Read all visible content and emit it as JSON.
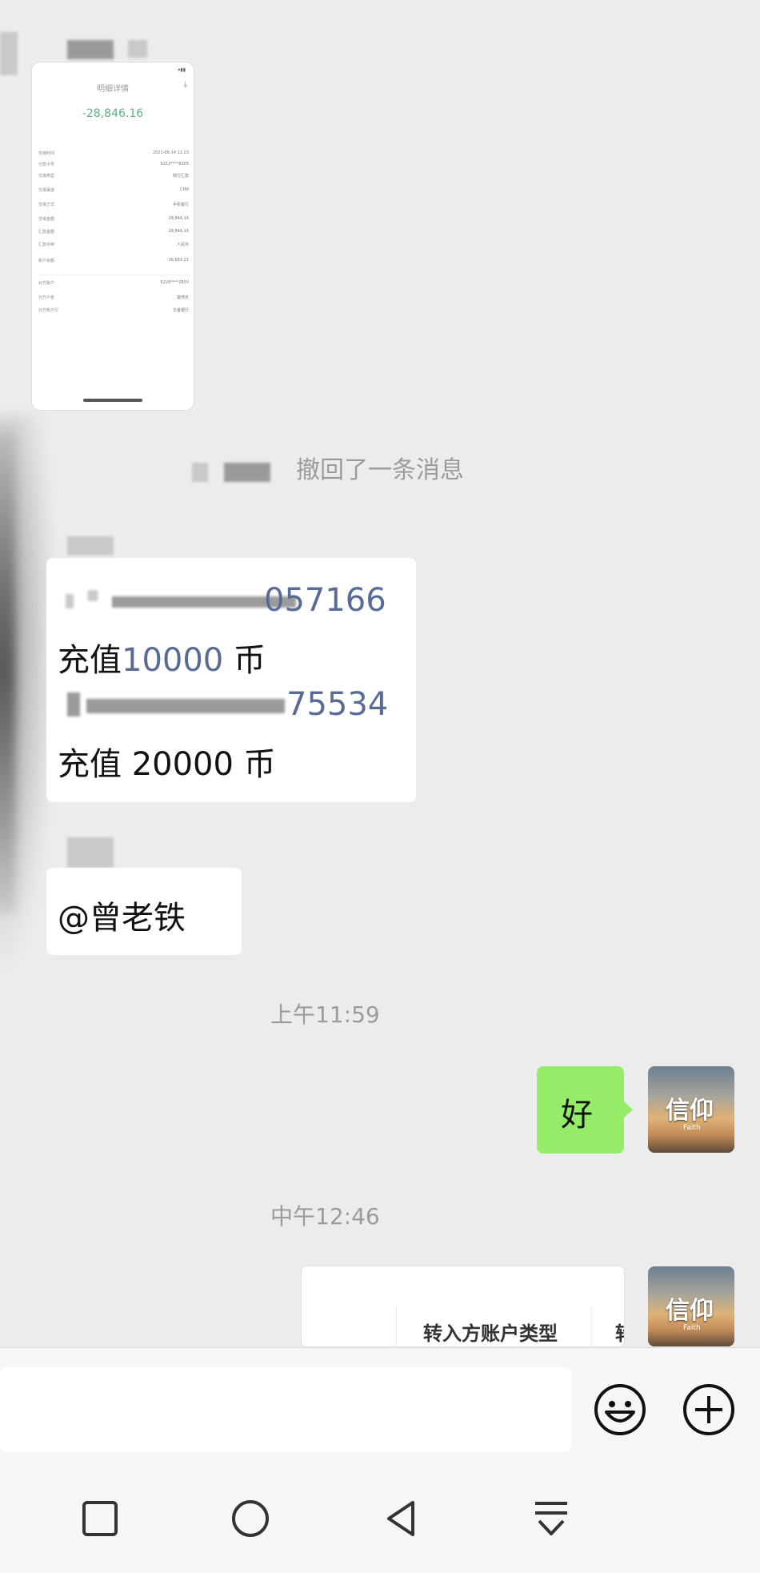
{
  "receipt": {
    "title": "明细详情",
    "amount": "-28,846.16",
    "rows": [
      {
        "k": "交易时间",
        "v": "2021-06-14 11:23"
      },
      {
        "k": "付款卡号",
        "v": "6212****8305"
      },
      {
        "k": "交易类型",
        "v": "跨行汇款"
      },
      {
        "k": "交易渠道",
        "v": "CHN"
      },
      {
        "k": "交易方式",
        "v": "手机银行"
      },
      {
        "k": "交易金额",
        "v": "28,846.16"
      },
      {
        "k": "汇款金额",
        "v": "28,846.16"
      },
      {
        "k": "汇款币种",
        "v": "人民币"
      },
      {
        "k": "账户余额",
        "v": "36,683.21"
      },
      {
        "k": "对方账户",
        "v": "6228****2820"
      },
      {
        "k": "对方户名",
        "v": "童伟天"
      },
      {
        "k": "对方账户行",
        "v": "华夏银行"
      }
    ]
  },
  "messages": {
    "recall_text": "撤回了一条消息",
    "bubble1": {
      "line1_suffix": "057166",
      "line2_prefix": "充值",
      "line2_value": "10000",
      "line2_suffix": "币",
      "line3_suffix": "75534",
      "line4": "充值 20000 币"
    },
    "mention": "@曾老铁",
    "time1": "上午11:59",
    "my_reply": "好",
    "time2": "中午12:46",
    "card_label": "转入方账户类型",
    "card_label_cut": "转"
  },
  "avatar": {
    "title": "信仰",
    "subtitle": "Faith"
  },
  "input": {
    "placeholder": ""
  },
  "icons": [
    "emoji-icon",
    "plus-icon",
    "square-nav-icon",
    "circle-nav-icon",
    "back-nav-icon",
    "collapse-nav-icon"
  ]
}
